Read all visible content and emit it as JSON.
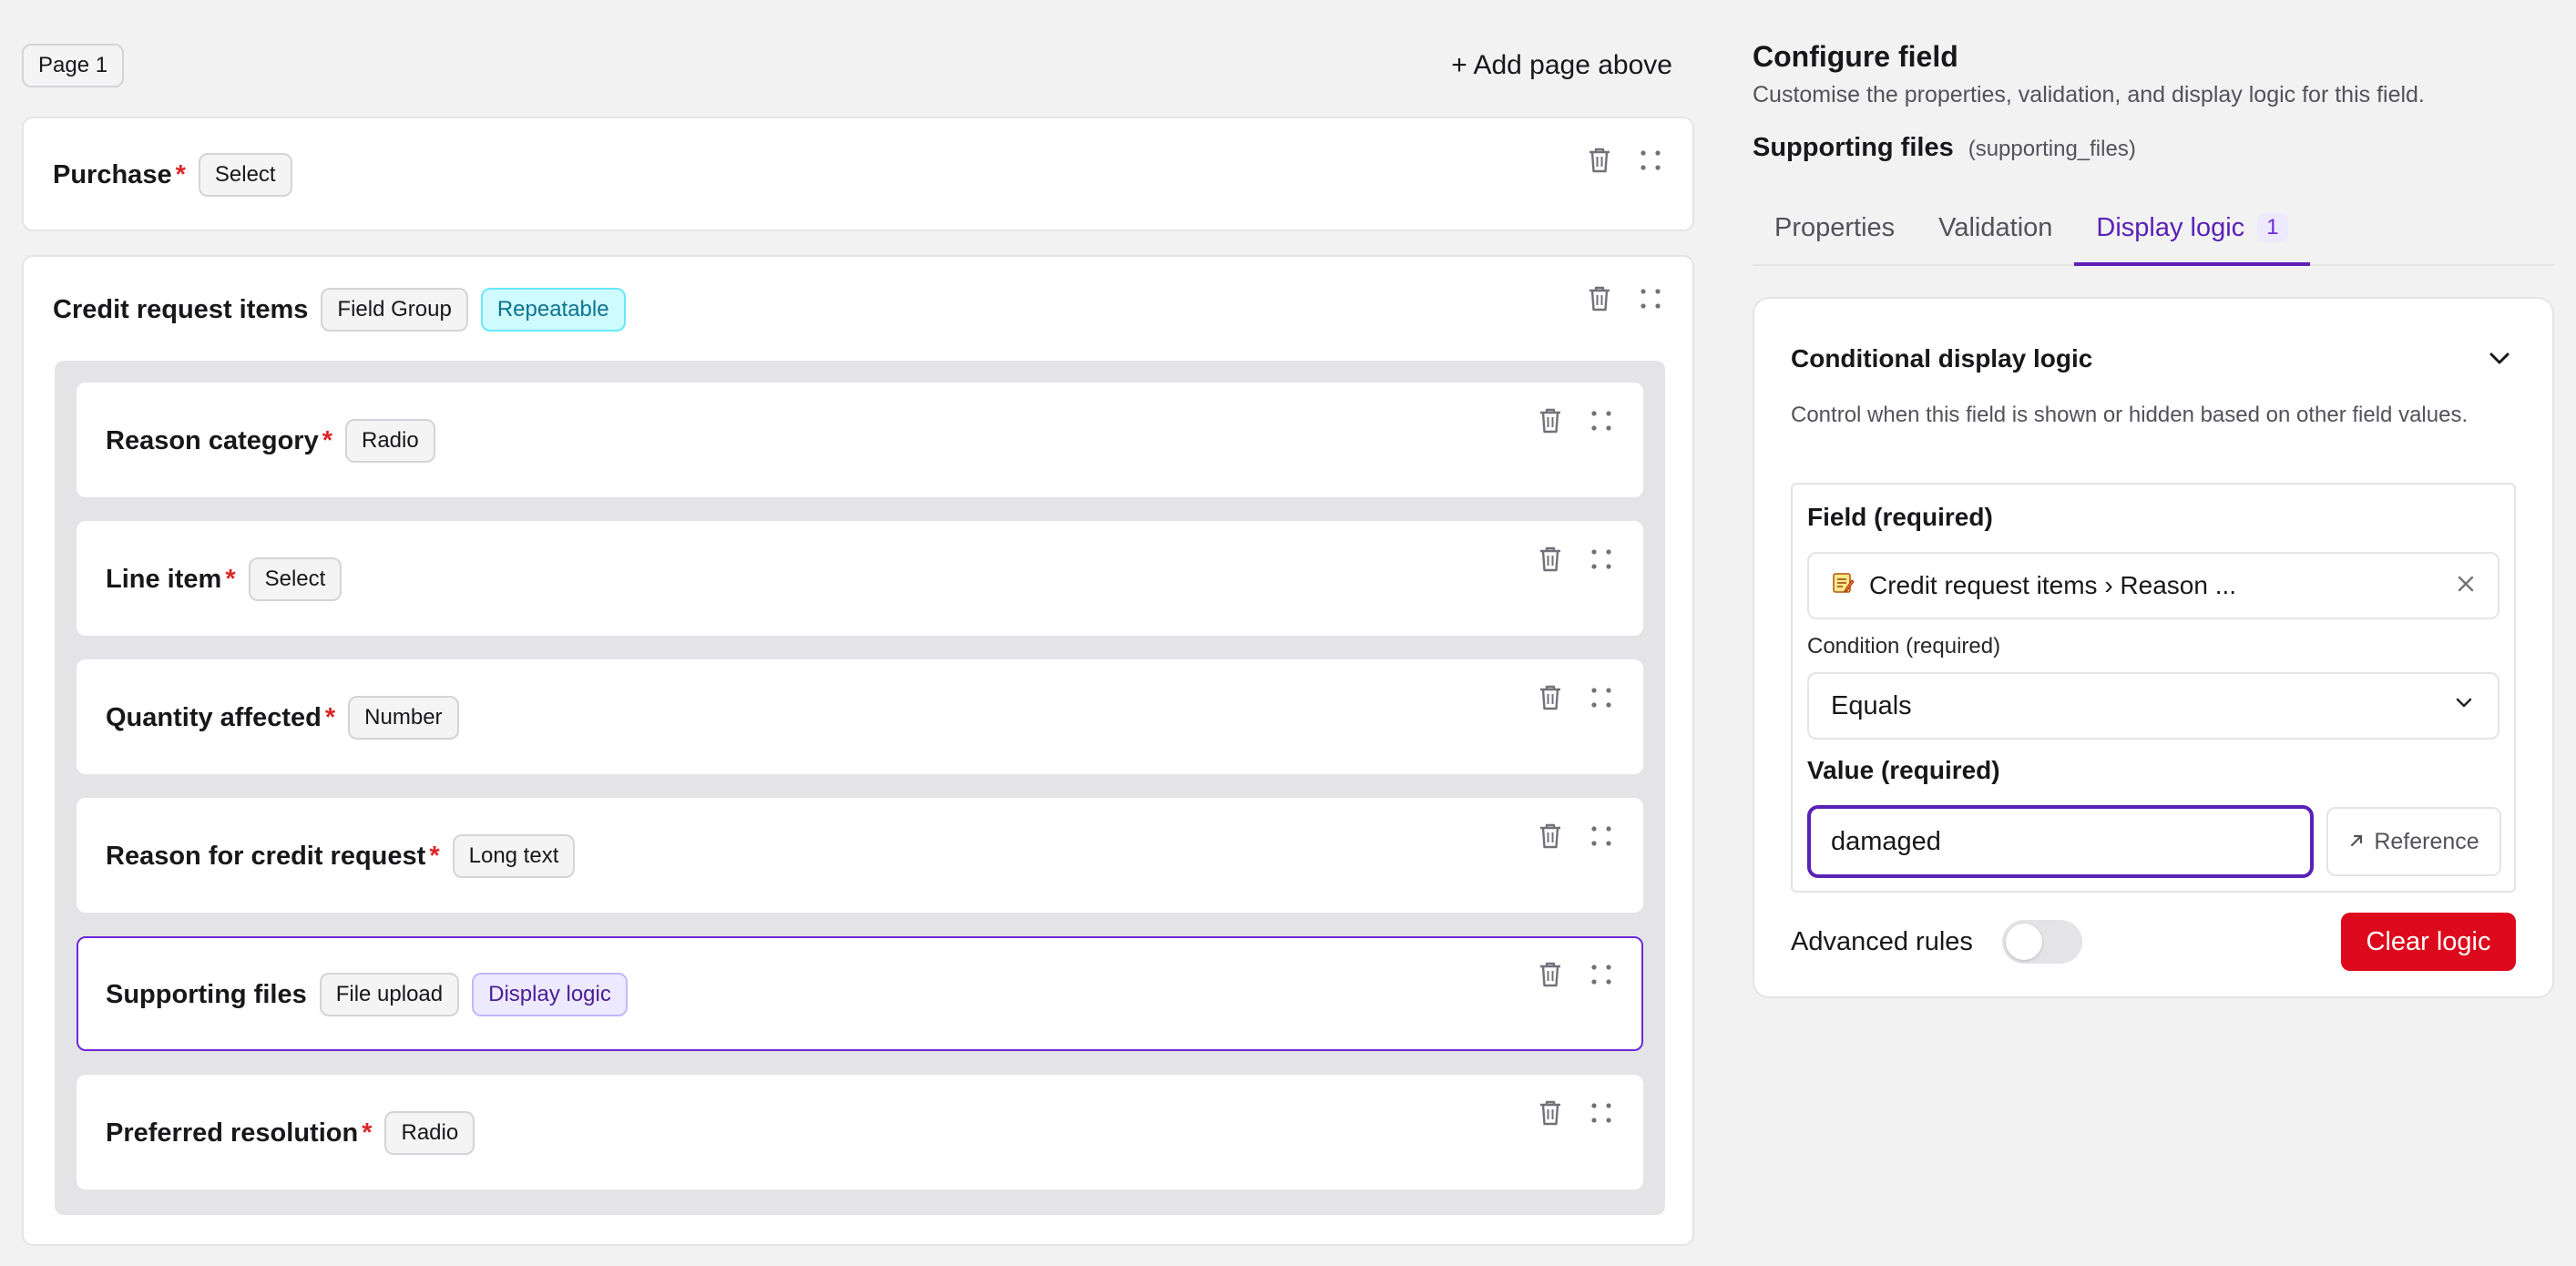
{
  "builder": {
    "page_badge": "Page 1",
    "add_page_label": "+ Add page above",
    "purchase": {
      "name": "Purchase",
      "required": "*",
      "type": "Select"
    },
    "group": {
      "name": "Credit request items",
      "type": "Field Group",
      "badge": "Repeatable",
      "fields": [
        {
          "name": "Reason category",
          "required": "*",
          "type": "Radio"
        },
        {
          "name": "Line item",
          "required": "*",
          "type": "Select"
        },
        {
          "name": "Quantity affected",
          "required": "*",
          "type": "Number"
        },
        {
          "name": "Reason for credit request",
          "required": "*",
          "type": "Long text"
        },
        {
          "name": "Supporting files",
          "type": "File upload",
          "badge": "Display logic"
        },
        {
          "name": "Preferred resolution",
          "required": "*",
          "type": "Radio"
        }
      ]
    }
  },
  "panel": {
    "title": "Configure field",
    "subtitle": "Customise the properties, validation, and display logic for this field.",
    "field_name": "Supporting files",
    "field_key": "(supporting_files)",
    "tabs": [
      {
        "label": "Properties"
      },
      {
        "label": "Validation"
      },
      {
        "label": "Display logic",
        "count": "1"
      }
    ],
    "logic": {
      "title": "Conditional display logic",
      "description": "Control when this field is shown or hidden based on other field values.",
      "field_label": "Field (required)",
      "field_value": "Credit request items › Reason ...",
      "condition_label": "Condition (required)",
      "condition_value": "Equals",
      "value_label": "Value (required)",
      "value": "damaged",
      "reference_label": "Reference",
      "advanced_label": "Advanced rules",
      "clear_label": "Clear logic"
    }
  },
  "colors": {
    "accent": "#5b21b6",
    "danger": "#dc0a1c",
    "required": "#dc2626",
    "repeatable_bg": "#cffafe"
  },
  "icons": [
    "trash-icon",
    "drag-handle-icon",
    "chevron-down-icon",
    "close-icon",
    "memo-icon",
    "arrow-up-right-icon"
  ]
}
